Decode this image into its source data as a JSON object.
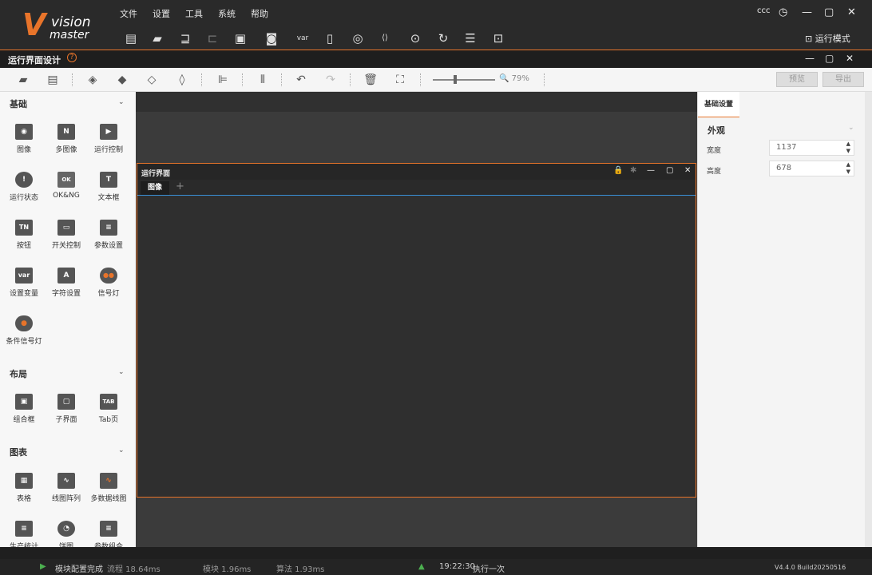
{
  "app": {
    "logo_word1": "vision",
    "logo_word2": "master",
    "logo_mark": "V"
  },
  "menu": [
    "文件",
    "设置",
    "工具",
    "系统",
    "帮助"
  ],
  "top_right": {
    "user": "ccc",
    "run_mode_label": "运行模式"
  },
  "toolbar_icons": [
    "save-icon",
    "open-folder-icon",
    "load-icon",
    "export-icon",
    "lock-icon",
    "camera-icon",
    "var-icon",
    "device-icon",
    "global-icon",
    "script-icon",
    "run-once-icon",
    "run-loop-icon",
    "list-icon",
    "report-icon"
  ],
  "designer": {
    "title": "运行界面设计",
    "help_mark": "?",
    "zoom": "79%",
    "preview_label": "预览",
    "export_label": "导出"
  },
  "left_panel": {
    "sections": [
      {
        "title": "基础",
        "items": [
          {
            "label": "图像",
            "icon": "camera-icon",
            "glyph": "◉"
          },
          {
            "label": "多图像",
            "icon": "multi-image-icon",
            "glyph": "N"
          },
          {
            "label": "运行控制",
            "icon": "play-icon",
            "glyph": "▶"
          },
          {
            "label": "运行状态",
            "icon": "status-icon",
            "glyph": "!"
          },
          {
            "label": "OK&NG",
            "icon": "ok-ng-icon",
            "glyph": "OK"
          },
          {
            "label": "文本框",
            "icon": "textbox-icon",
            "glyph": "T"
          },
          {
            "label": "按钮",
            "icon": "button-icon",
            "glyph": "TN"
          },
          {
            "label": "开关控制",
            "icon": "switch-icon",
            "glyph": "▭"
          },
          {
            "label": "参数设置",
            "icon": "param-icon",
            "glyph": "≡"
          },
          {
            "label": "设置变量",
            "icon": "var-icon",
            "glyph": "var"
          },
          {
            "label": "字符设置",
            "icon": "char-icon",
            "glyph": "A"
          },
          {
            "label": "信号灯",
            "icon": "signal-light-icon",
            "glyph": "●●"
          },
          {
            "label": "条件信号灯",
            "icon": "cond-signal-icon",
            "glyph": "●"
          }
        ]
      },
      {
        "title": "布局",
        "items": [
          {
            "label": "组合框",
            "icon": "group-box-icon",
            "glyph": "▣"
          },
          {
            "label": "子界面",
            "icon": "sub-view-icon",
            "glyph": "▢"
          },
          {
            "label": "Tab页",
            "icon": "tab-icon",
            "glyph": "TAB"
          }
        ]
      },
      {
        "title": "图表",
        "items": [
          {
            "label": "表格",
            "icon": "table-icon",
            "glyph": "▦"
          },
          {
            "label": "线图阵列",
            "icon": "line-array-icon",
            "glyph": "∿"
          },
          {
            "label": "多数据线图",
            "icon": "multi-line-icon",
            "glyph": "∿"
          },
          {
            "label": "生产统计",
            "icon": "prod-stat-icon",
            "glyph": "≡"
          },
          {
            "label": "饼图",
            "icon": "pie-icon",
            "glyph": "◔"
          },
          {
            "label": "参数组合",
            "icon": "param-combo-icon",
            "glyph": "≡"
          }
        ]
      }
    ]
  },
  "run_window": {
    "title": "运行界面",
    "tab": "图像",
    "add": "+"
  },
  "right_panel": {
    "tab": "基础设置",
    "section": "外观",
    "width_label": "宽度",
    "width_value": "1137",
    "height_label": "高度",
    "height_value": "678"
  },
  "status": {
    "msg": "模块配置完成",
    "flow": "流程 18.64ms",
    "module": "模块 1.96ms",
    "algo": "算法 1.93ms",
    "time": "19:22:30",
    "exec": "执行一次",
    "version": "V4.4.0 Build20250516"
  },
  "colors": {
    "accent": "#e8742a",
    "blue": "#3a8fd6"
  }
}
